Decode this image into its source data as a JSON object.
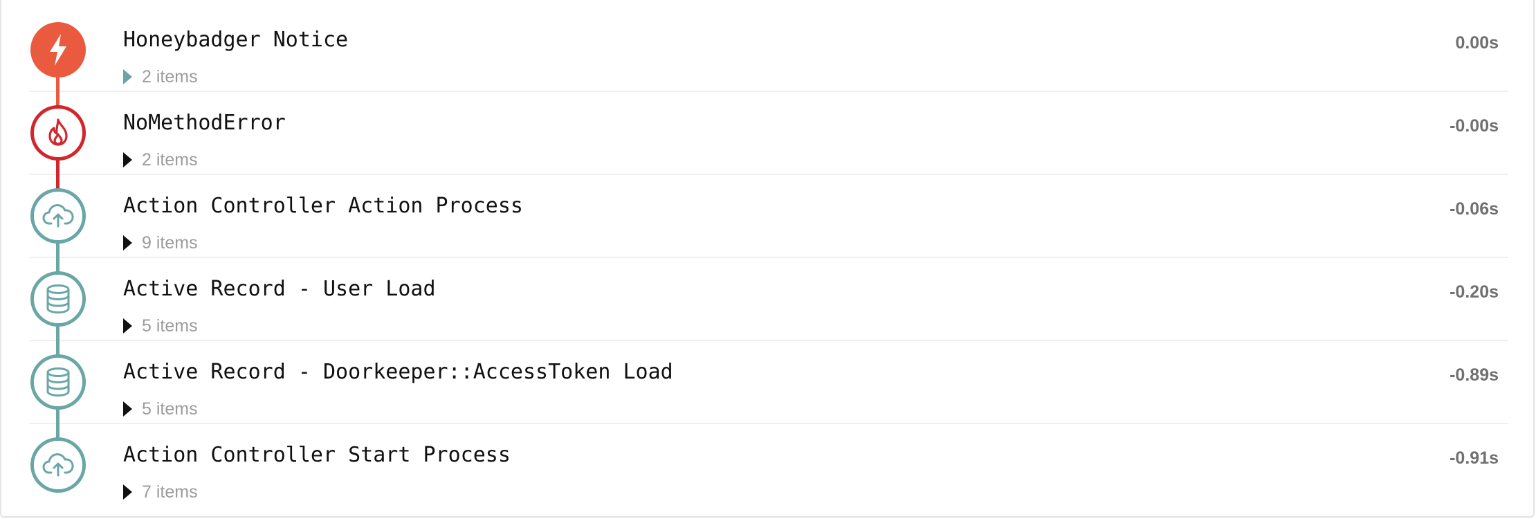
{
  "colors": {
    "notice_fill": "#ea5a3e",
    "error_red": "#d1262b",
    "teal": "#6aa6a6",
    "title_text": "#111111",
    "muted_text": "#9b9b9b",
    "time_text": "#707070"
  },
  "events": [
    {
      "title": "Honeybadger Notice",
      "items_label": "2 items",
      "time": "0.00s",
      "icon": "lightning-icon"
    },
    {
      "title": "NoMethodError",
      "items_label": "2 items",
      "time": "-0.00s",
      "icon": "flame-icon"
    },
    {
      "title": "Action Controller Action Process",
      "items_label": "9 items",
      "time": "-0.06s",
      "icon": "cloud-upload-icon"
    },
    {
      "title": "Active Record - User Load",
      "items_label": "5 items",
      "time": "-0.20s",
      "icon": "database-icon"
    },
    {
      "title": "Active Record - Doorkeeper::AccessToken Load",
      "items_label": "5 items",
      "time": "-0.89s",
      "icon": "database-icon"
    },
    {
      "title": "Action Controller Start Process",
      "items_label": "7 items",
      "time": "-0.91s",
      "icon": "cloud-upload-icon"
    }
  ]
}
